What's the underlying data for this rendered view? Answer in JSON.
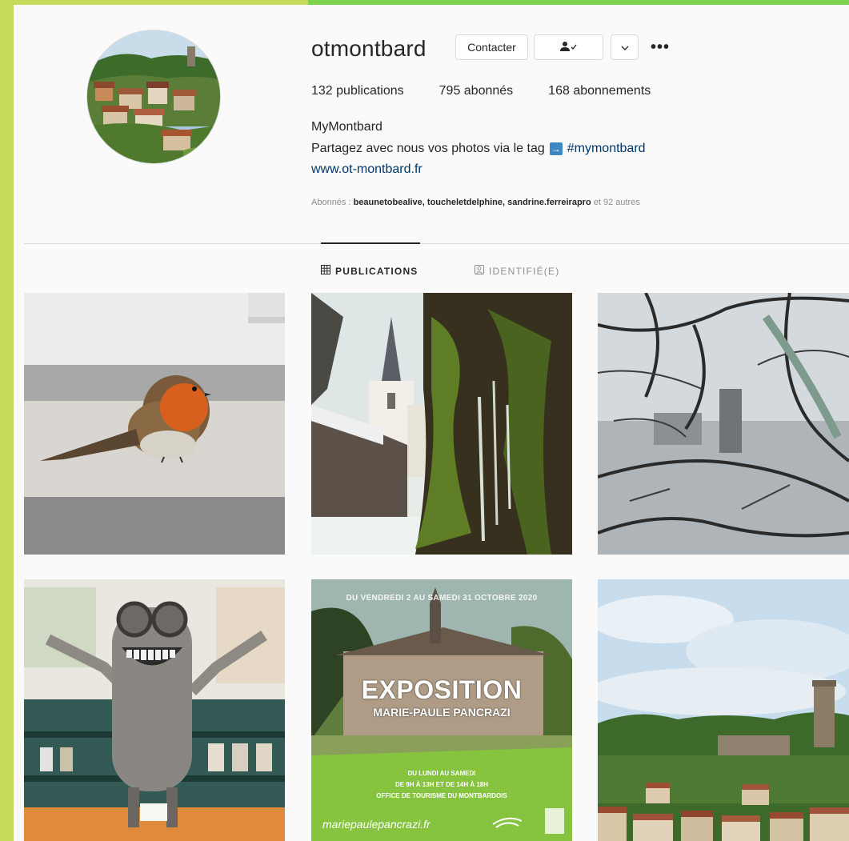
{
  "profile": {
    "username": "otmontbard",
    "contact_label": "Contacter",
    "follow_icon": "person-check-icon",
    "dropdown_icon": "chevron-down-icon",
    "more_label": "•••",
    "stats": {
      "posts": "132 publications",
      "followers": "795 abonnés",
      "following": "168 abonnements"
    },
    "full_name": "MyMontbard",
    "bio_text": "Partagez avec nous vos photos via le tag",
    "bio_arrow": "→",
    "bio_hashtag": "#mymontbard",
    "website": "www.ot-montbard.fr",
    "followed_prefix": "Abonnés : ",
    "followed_names": "beaunetobealive, toucheletdelphine, sandrine.ferreirapro",
    "followed_suffix": " et 92 autres"
  },
  "tabs": [
    {
      "label": "PUBLICATIONS",
      "icon": "grid-icon",
      "active": true
    },
    {
      "label": "IDENTIFIÉ(E)",
      "icon": "tagged-icon",
      "active": false
    }
  ],
  "posts": {
    "p5": {
      "top_text": "DU VENDREDI 2 AU SAMEDI 31 OCTOBRE 2020",
      "title": "EXPOSITION",
      "subtitle": "MARIE-PAULE PANCRAZI",
      "line1": "DU LUNDI AU SAMEDI",
      "line2": "DE 9H À 13H ET DE 14H À 18H",
      "line3": "OFFICE DE TOURISME DU MONTBARDOIS",
      "website": "mariepaulepancrazi.fr"
    }
  },
  "colors": {
    "frame_left": "#c5dc5a",
    "frame_top": "#7fd44f",
    "link": "#00376b",
    "muted": "#8e8e8e",
    "border": "#dbdbdb"
  }
}
